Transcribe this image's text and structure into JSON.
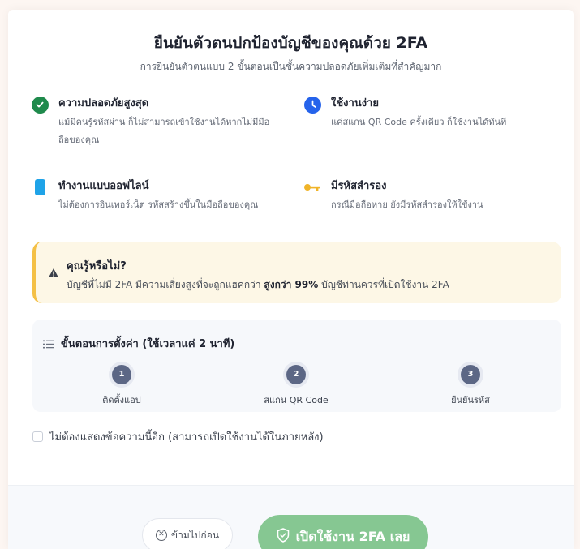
{
  "modal": {
    "title": "ยืนยันตัวตนปกป้องบัญชีของคุณด้วย 2FA",
    "subtitle": "การยืนยันตัวตนแบบ 2 ขั้นตอนเป็นชั้นความปลอดภัยเพิ่มเติมที่สำคัญมาก"
  },
  "features": [
    {
      "icon": "check-circle-icon",
      "title": "ความปลอดภัยสูงสุด",
      "desc": "แม้มีคนรู้รหัสผ่าน ก็ไม่สามารถเข้าใช้งานได้หากไม่มีมือถือของคุณ"
    },
    {
      "icon": "clock-icon",
      "title": "ใช้งานง่าย",
      "desc": "แค่สแกน QR Code ครั้งเดียว ก็ใช้งานได้ทันที"
    },
    {
      "icon": "phone-icon",
      "title": "ทำงานแบบออฟไลน์",
      "desc": "ไม่ต้องการอินเทอร์เน็ต รหัสสร้างขึ้นในมือถือของคุณ"
    },
    {
      "icon": "key-icon",
      "title": "มีรหัสสำรอง",
      "desc": "กรณีมือถือหาย ยังมีรหัสสำรองให้ใช้งาน"
    }
  ],
  "tip": {
    "title": "คุณรู้หรือไม่?",
    "text_before": "บัญชีที่ไม่มี 2FA มีความเสี่ยงสูงที่จะถูกแฮคกว่า ",
    "text_bold": "สูงกว่า 99%",
    "text_after": " บัญชีท่านควรที่เปิดใช้งาน 2FA"
  },
  "steps": {
    "title": "ขั้นตอนการตั้งค่า (ใช้เวลาแค่ 2 นาที)",
    "items": [
      {
        "num": "1",
        "label": "ติดตั้งแอป"
      },
      {
        "num": "2",
        "label": "สแกน QR Code"
      },
      {
        "num": "3",
        "label": "ยืนยันรหัส"
      }
    ]
  },
  "optout": {
    "label": "ไม่ต้องแสดงข้อความนี้อีก (สามารถเปิดใช้งานได้ในภายหลัง)",
    "checked": false
  },
  "footer": {
    "skip_label": "ข้ามไปก่อน",
    "enable_label": "เปิดใช้งาน 2FA เลย"
  },
  "colors": {
    "success": "#1f8a4c",
    "clock": "#2563eb",
    "phone": "#1fa3e8",
    "key": "#f0b429",
    "tip_bg": "#fdf7e6",
    "tip_border": "#f4c046",
    "primary_button": "#86c792"
  }
}
